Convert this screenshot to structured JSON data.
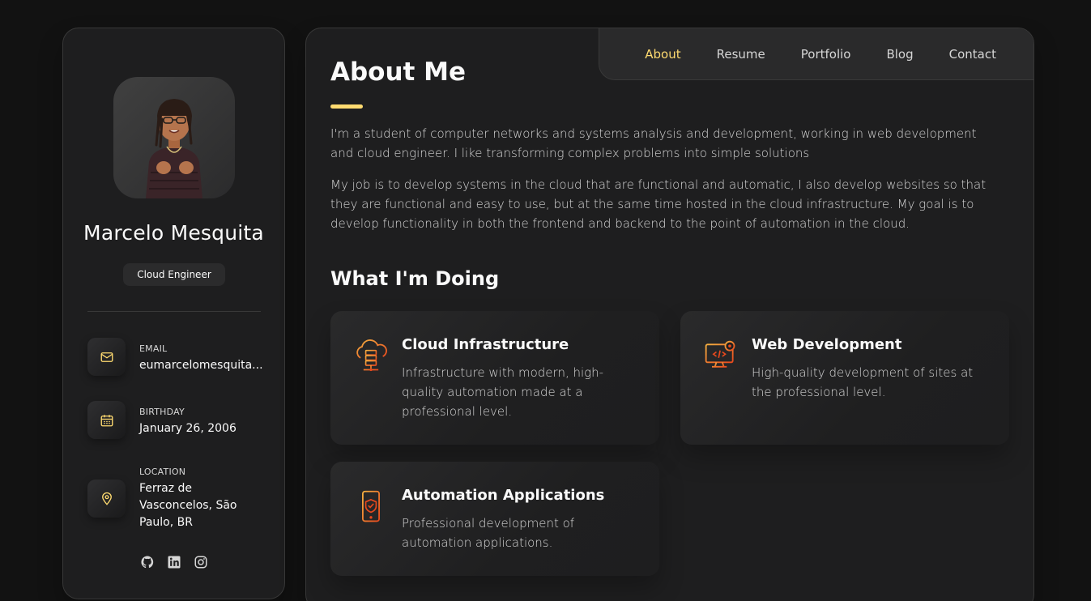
{
  "colors": {
    "accent": "#ffdb70",
    "background": "#121212",
    "panel": "#1e1e1f",
    "text": "#fafafa",
    "muted_text": "#d6d6d6"
  },
  "profile": {
    "name": "Marcelo Mesquita",
    "role": "Cloud Engineer"
  },
  "contacts": [
    {
      "icon": "mail-icon",
      "label": "Email",
      "value": "eumarcelomesquita..."
    },
    {
      "icon": "calendar-icon",
      "label": "Birthday",
      "value": "January 26, 2006"
    },
    {
      "icon": "map-pin-icon",
      "label": "Location",
      "value": "Ferraz de Vasconcelos, São Paulo, BR"
    }
  ],
  "socials": [
    {
      "icon": "github-icon"
    },
    {
      "icon": "linkedin-icon"
    },
    {
      "icon": "instagram-icon"
    }
  ],
  "nav": {
    "items": [
      "About",
      "Resume",
      "Portfolio",
      "Blog",
      "Contact"
    ],
    "active": "About"
  },
  "about": {
    "title": "About Me",
    "paragraphs": [
      "I'm a student of computer networks and systems analysis and development, working in web development and cloud engineer. I like transforming complex problems into simple solutions",
      "My job is to develop systems in the cloud that are functional and automatic, I also develop websites so that they are functional and easy to use, but at the same time hosted in the cloud infrastructure. My goal is to develop functionality in both the frontend and backend to the point of automation in the cloud."
    ]
  },
  "services": {
    "title": "What I'm Doing",
    "items": [
      {
        "icon": "cloud-server-icon",
        "title": "Cloud Infrastructure",
        "text": "Infrastructure with modern, high-quality automation made at a professional level."
      },
      {
        "icon": "web-dev-monitor-icon",
        "title": "Web Development",
        "text": "High-quality development of sites at the professional level."
      },
      {
        "icon": "mobile-automation-icon",
        "title": "Automation Applications",
        "text": "Professional development of automation applications."
      }
    ]
  }
}
